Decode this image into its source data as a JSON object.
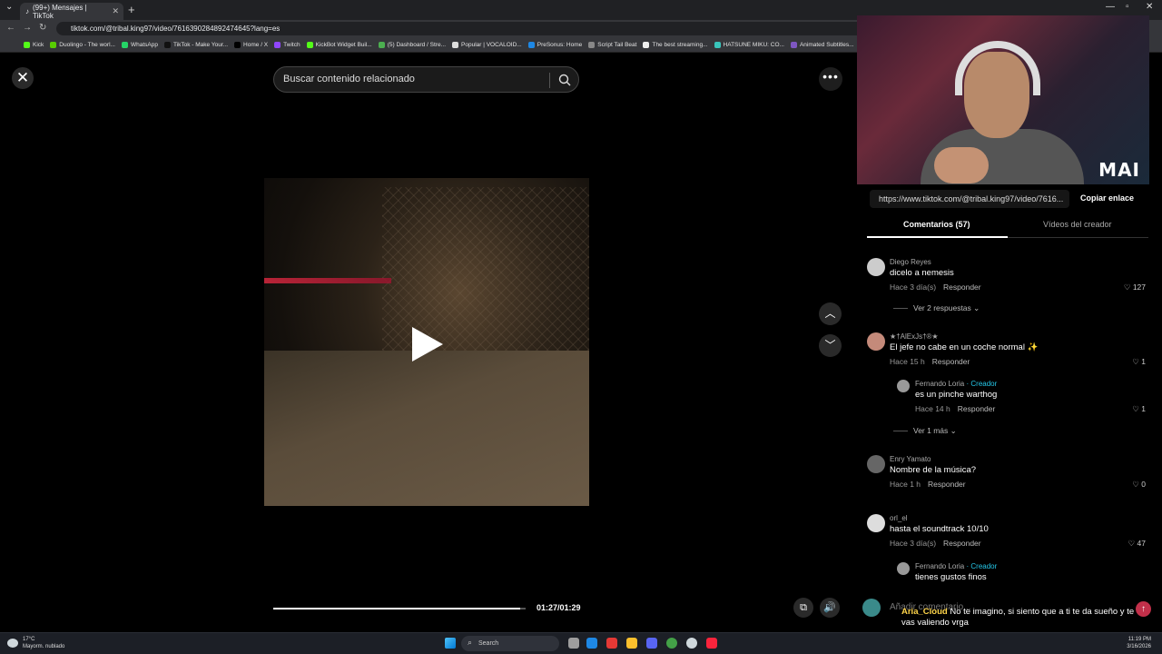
{
  "browser": {
    "tab_title": "(99+) Mensajes | TikTok",
    "url": "tiktok.com/@tribal.king97/video/7616390284892474645?lang=es",
    "bookmarks": [
      {
        "label": "Kick",
        "color": "#53fc18"
      },
      {
        "label": "Duolingo - The worl...",
        "color": "#58cc02"
      },
      {
        "label": "WhatsApp",
        "color": "#25d366"
      },
      {
        "label": "TikTok - Make Your...",
        "color": "#111111"
      },
      {
        "label": "Home / X",
        "color": "#000000"
      },
      {
        "label": "Twitch",
        "color": "#9146ff"
      },
      {
        "label": "KickBot Widget Buil...",
        "color": "#53fc18"
      },
      {
        "label": "(5) Dashboard / Stre...",
        "color": "#4caf50"
      },
      {
        "label": "Popular | VOCALOID...",
        "color": "#dddddd"
      },
      {
        "label": "PreSonus: Home",
        "color": "#1e88e5"
      },
      {
        "label": "Script Tail Beat",
        "color": "#888888"
      },
      {
        "label": "The best streaming...",
        "color": "#eeeeee"
      },
      {
        "label": "HATSUNE MIKU: CO...",
        "color": "#39c5bb"
      },
      {
        "label": "Animated Subtitles...",
        "color": "#7e57c2"
      }
    ]
  },
  "search": {
    "placeholder": "Buscar contenido relacionado"
  },
  "video": {
    "time": "01:27/01:29",
    "progress": 0.977
  },
  "webcam": {
    "watermark": "MAI"
  },
  "share": {
    "link": "https://www.tiktok.com/@tribal.king97/video/7616...",
    "copy_label": "Copiar enlace"
  },
  "tabs": {
    "comments": "Comentarios (57)",
    "creator_videos": "Vídeos del creador"
  },
  "comments": [
    {
      "user": "Diego Reyes",
      "text": "dicelo a nemesis",
      "time": "Hace 3 día(s)",
      "reply": "Responder",
      "likes": "127",
      "more": "Ver 2 respuestas"
    },
    {
      "user": "★†AlExJs†®★",
      "text": "El jefe no cabe en un coche normal ✨",
      "time": "Hace 15 h",
      "reply": "Responder",
      "likes": "1"
    },
    {
      "user": "Fernando Loria",
      "creator_label": "· Creador",
      "text": "es un pinche warthog",
      "time": "Hace 14 h",
      "reply": "Responder",
      "likes": "1",
      "more": "Ver 1 más"
    },
    {
      "user": "Enry Yamato",
      "text": "Nombre de la música?",
      "time": "Hace 1 h",
      "reply": "Responder",
      "likes": "0"
    },
    {
      "user": "orl_el",
      "text": "hasta el soundtrack 10/10",
      "time": "Hace 3 día(s)",
      "reply": "Responder",
      "likes": "47"
    },
    {
      "user": "Fernando Loria",
      "creator_label": "· Creador",
      "text": "tienes gustos finos"
    }
  ],
  "comment_input": {
    "placeholder": "Añadir comentario..."
  },
  "overlay_chat": {
    "user": "Aria_Cloud",
    "text": "No te imagino, si siento que a ti te da sueño y te vas valiendo vrga"
  },
  "taskbar": {
    "temperature": "17°C",
    "weather": "Mayorm. nublado",
    "search": "Search",
    "time": "11:19 PM",
    "date": "3/16/2026"
  }
}
